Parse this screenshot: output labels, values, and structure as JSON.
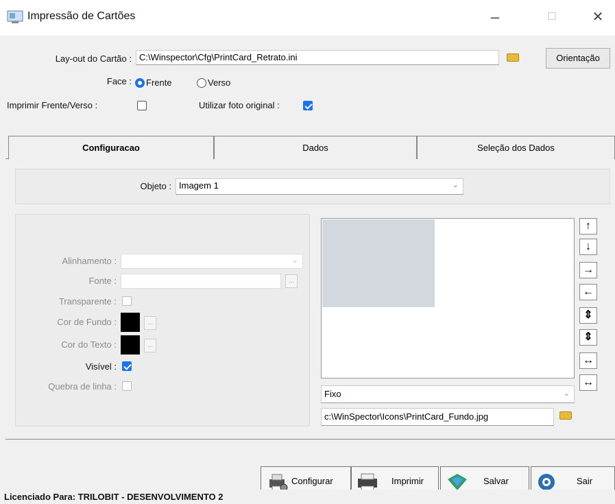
{
  "window": {
    "title": "Impressão de Cartões",
    "controls": {
      "minimize": "–",
      "maximize": "☐",
      "close": "✕"
    }
  },
  "header": {
    "layout_label": "Lay-out do Cartão :",
    "layout_value": "C:\\Winspector\\Cfg\\PrintCard_Retrato.ini",
    "orientation_button": "Orientação",
    "face_label": "Face :",
    "face_options": [
      "Frente",
      "Verso"
    ],
    "face_selected": "Frente",
    "print_both_label": "Imprimir Frente/Verso :",
    "print_both_checked": false,
    "original_photo_label": "Utilizar foto original :",
    "original_photo_checked": true
  },
  "tabs": [
    {
      "label": "Configuracao",
      "active": true
    },
    {
      "label": "Dados",
      "active": false
    },
    {
      "label": "Seleção dos Dados",
      "active": false
    }
  ],
  "config": {
    "object_label": "Objeto :",
    "object_value": "Imagem 1",
    "alignment_label": "Alinhamento :",
    "alignment_value": "",
    "font_label": "Fonte :",
    "font_value": "",
    "transparent_label": "Transparente :",
    "transparent_checked": false,
    "bg_color_label": "Cor de Fundo :",
    "bg_color": "#000000",
    "text_color_label": "Cor do Texto :",
    "text_color": "#000000",
    "visible_label": "Visível :",
    "visible_checked": true,
    "line_break_label": "Quebra de linha :",
    "line_break_checked": false,
    "ellipsis": "...",
    "position_mode": "Fixo",
    "image_path": "c:\\WinSpector\\Icons\\PrintCard_Fundo.jpg"
  },
  "side_controls": [
    "↑",
    "↓",
    "→",
    "←",
    "⇕",
    "⇕",
    "↔",
    "↔"
  ],
  "buttons": {
    "configure": "Configurar",
    "print": "Imprimir",
    "save": "Salvar",
    "exit": "Sair"
  },
  "status": "Licenciado Para: TRILOBIT - DESENVOLVIMENTO 2",
  "colors": {
    "accent": "#1a73e8",
    "preview_block": "#d3d8df"
  }
}
